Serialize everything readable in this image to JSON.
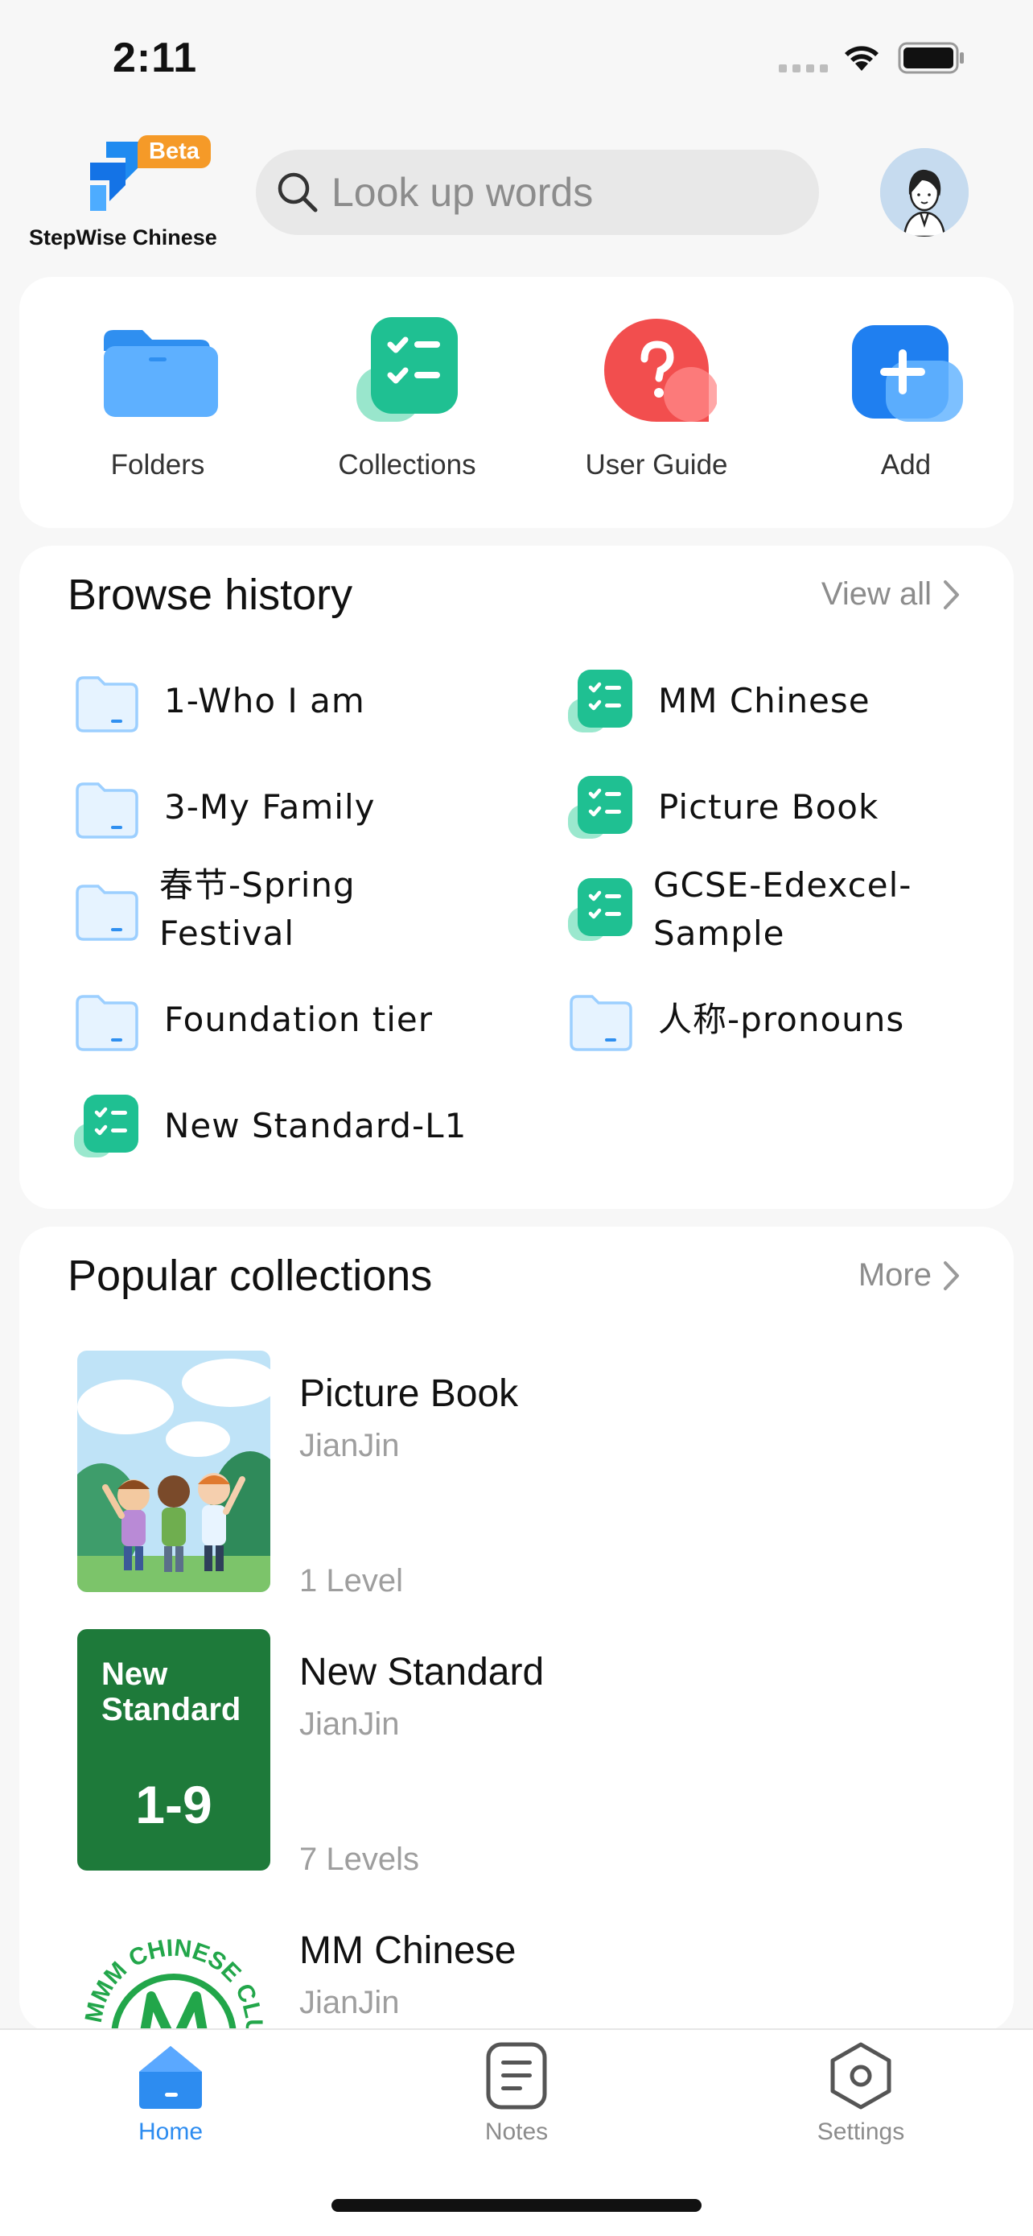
{
  "status_bar": {
    "time": "2:11"
  },
  "header": {
    "app_name": "StepWise Chinese",
    "beta_badge": "Beta",
    "search_placeholder": "Look up words"
  },
  "quick_actions": [
    {
      "label": "Folders",
      "icon": "folder-icon"
    },
    {
      "label": "Collections",
      "icon": "checklist-icon"
    },
    {
      "label": "User Guide",
      "icon": "question-icon"
    },
    {
      "label": "Add",
      "icon": "plus-icon"
    }
  ],
  "browse_history": {
    "title": "Browse history",
    "link": "View all",
    "items": [
      {
        "label": "1-Who I am",
        "type": "folder"
      },
      {
        "label": "MM Chinese",
        "type": "collection"
      },
      {
        "label": "3-My Family",
        "type": "folder"
      },
      {
        "label": "Picture Book",
        "type": "collection"
      },
      {
        "label": "春节-Spring\nFestival",
        "type": "folder"
      },
      {
        "label": "GCSE-Edexcel-\nSample",
        "type": "collection"
      },
      {
        "label": "Foundation tier",
        "type": "folder"
      },
      {
        "label": "人称-pronouns",
        "type": "folder"
      },
      {
        "label": "New Standard-L1",
        "type": "collection"
      }
    ]
  },
  "popular_collections": {
    "title": "Popular collections",
    "link": "More",
    "items": [
      {
        "title": "Picture Book",
        "author": "JianJin",
        "levels": "1 Level"
      },
      {
        "title": "New Standard",
        "author": "JianJin",
        "levels": "7 Levels",
        "cover_line1": "New",
        "cover_line2": "Standard",
        "cover_number": "1-9"
      },
      {
        "title": "MM Chinese",
        "author": "JianJin",
        "levels": "",
        "cover_text": "MMM CHINESE CLUB"
      }
    ]
  },
  "tabbar": [
    {
      "label": "Home",
      "active": true
    },
    {
      "label": "Notes",
      "active": false
    },
    {
      "label": "Settings",
      "active": false
    }
  ],
  "colors": {
    "accent": "#2d8cf0",
    "green": "#1fc092",
    "red": "#f24e4e",
    "orange": "#f59a28",
    "dark_green": "#1e7a3a"
  }
}
